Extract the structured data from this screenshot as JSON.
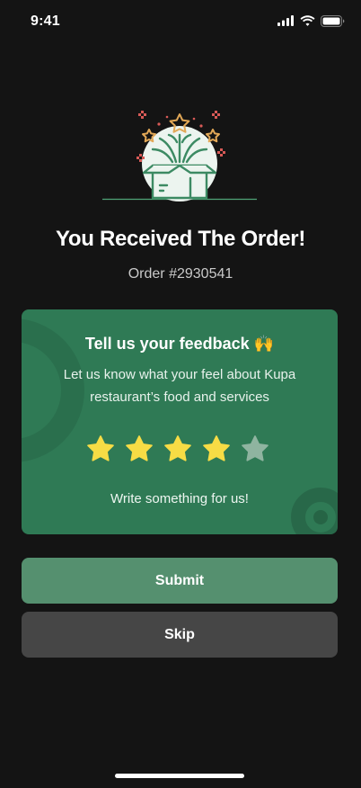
{
  "status_bar": {
    "time": "9:41",
    "icons": [
      "signal-icon",
      "wifi-icon",
      "battery-icon"
    ]
  },
  "hero": {
    "icon": "gift-box-icon",
    "colors": {
      "circle": "#ecf4ef",
      "box": "#3c8a63",
      "accent": "#e2a857",
      "sparkle": "#d85a57"
    }
  },
  "title": "You Received The Order!",
  "order_number": "Order #2930541",
  "feedback_card": {
    "title": "Tell us your feedback 🙌",
    "description": "Let us know what your feel about  Kupa restaurant’s food and services",
    "rating": {
      "value": 4,
      "max": 5
    },
    "prompt": "Write something for us!",
    "colors": {
      "card": "#2f7a55",
      "star_filled": "#f7dc45",
      "star_empty": "#8fb4a0"
    }
  },
  "actions": {
    "submit_label": "Submit",
    "skip_label": "Skip"
  },
  "colors": {
    "background": "#141414",
    "submit": "#55906f",
    "skip": "#464646"
  }
}
